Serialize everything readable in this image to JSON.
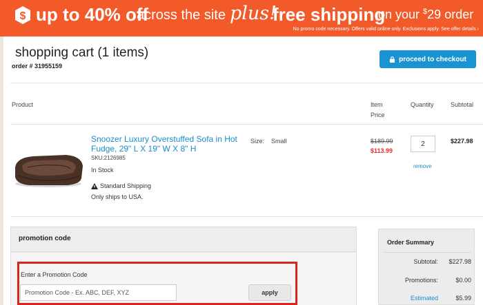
{
  "banner": {
    "part1": "up to 40% off",
    "part2": "across the site",
    "part3": "plus!",
    "part4": "free shipping",
    "part5_prefix": "on your ",
    "part5_sup": "$",
    "part5_suffix": "29 order",
    "fine_print": "No promo code necessary. Offers valid online only. Exclusions apply. See offer details ›",
    "bg_color": "#f25a29"
  },
  "cart": {
    "title": "shopping cart (1 items)",
    "order_number": "order # 31955159",
    "checkout_label": "proceed to checkout",
    "checkout_color": "#1a93d2"
  },
  "table": {
    "headers": {
      "product": "Product",
      "item_price_line1": "Item",
      "item_price_line2": "Price",
      "quantity": "Quantity",
      "subtotal": "Subtotal"
    }
  },
  "item": {
    "name": "Snoozer Luxury Overstuffed Sofa in Hot Fudge, 29\" L X 19\" W X 8\" H",
    "sku": "SKU:2126985",
    "stock": "In Stock",
    "shipping": "Standard Shipping",
    "ships_to": "Only ships to USA.",
    "size_label": "Size:",
    "size_value": "Small",
    "original_price": "$189.99",
    "sale_price": "$113.99",
    "quantity": "2",
    "remove_label": "remove",
    "subtotal": "$227.98"
  },
  "promotion": {
    "title": "promotion code",
    "input_label": "Enter a Promotion Code",
    "input_placeholder": "Promotion Code - Ex. ABC, DEF, XYZ",
    "apply_label": "apply"
  },
  "summary": {
    "title": "Order Summary",
    "subtotal_label": "Subtotal:",
    "subtotal_value": "$227.98",
    "promotions_label": "Promotions:",
    "promotions_value": "$0.00",
    "estimated_label": "Estimated",
    "estimated_value": "$5.99"
  }
}
